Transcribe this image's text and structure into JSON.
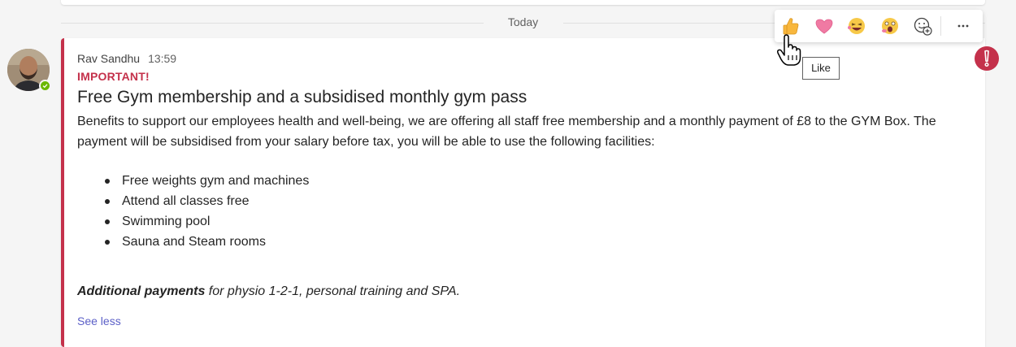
{
  "divider": {
    "label": "Today"
  },
  "message": {
    "author": "Rav Sandhu",
    "time": "13:59",
    "importance": "IMPORTANT!",
    "subject": "Free Gym membership and a subsidised monthly gym pass",
    "body": "Benefits to support our employees health and well-being, we are offering all staff free membership and a monthly payment of £8 to the GYM Box. The payment will be subsidised from your salary before tax, you will be able to use the following facilities:",
    "facilities": [
      "Free weights gym and machines",
      "Attend all classes free",
      "Swimming pool",
      "Sauna and Steam rooms"
    ],
    "additional_bold": "Additional payments",
    "additional_rest": " for physio 1-2-1, personal training and SPA.",
    "see_less": "See less"
  },
  "reactions": {
    "items": [
      "like-icon",
      "heart-icon",
      "laugh-icon",
      "surprised-icon",
      "add-reaction-icon"
    ],
    "more_icon": "more-options-icon"
  },
  "tooltip": {
    "label": "Like"
  },
  "colors": {
    "importance": "#c4314b",
    "link": "#5b5fc7",
    "presence": "#6bb700",
    "like": "#f8b73d",
    "heart": "#f07aa3"
  }
}
